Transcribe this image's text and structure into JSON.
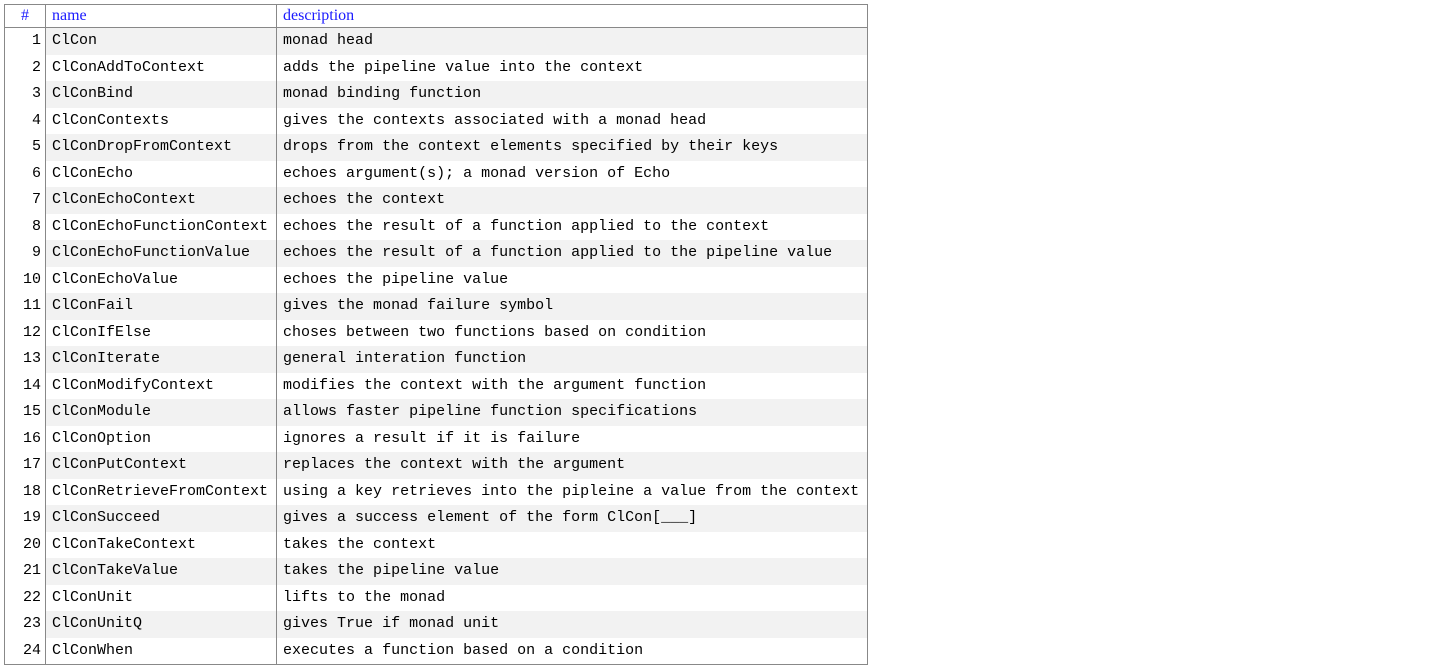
{
  "headers": {
    "index": "#",
    "name": "name",
    "description": "description"
  },
  "rows": [
    {
      "i": "1",
      "name": "ClCon",
      "desc": "monad head"
    },
    {
      "i": "2",
      "name": "ClConAddToContext",
      "desc": "adds the pipeline value into the context"
    },
    {
      "i": "3",
      "name": "ClConBind",
      "desc": "monad binding function"
    },
    {
      "i": "4",
      "name": "ClConContexts",
      "desc": "gives the contexts associated with a monad head"
    },
    {
      "i": "5",
      "name": "ClConDropFromContext",
      "desc": "drops from the context elements specified by their keys"
    },
    {
      "i": "6",
      "name": "ClConEcho",
      "desc": "echoes argument(s); a monad version of Echo"
    },
    {
      "i": "7",
      "name": "ClConEchoContext",
      "desc": "echoes the context"
    },
    {
      "i": "8",
      "name": "ClConEchoFunctionContext",
      "desc": "echoes the result of a function applied to the context"
    },
    {
      "i": "9",
      "name": "ClConEchoFunctionValue",
      "desc": "echoes the result of a function applied to the pipeline value"
    },
    {
      "i": "10",
      "name": "ClConEchoValue",
      "desc": "echoes the pipeline value"
    },
    {
      "i": "11",
      "name": "ClConFail",
      "desc": "gives the monad failure symbol"
    },
    {
      "i": "12",
      "name": "ClConIfElse",
      "desc": "choses between two functions based on condition"
    },
    {
      "i": "13",
      "name": "ClConIterate",
      "desc": "general interation function"
    },
    {
      "i": "14",
      "name": "ClConModifyContext",
      "desc": "modifies the context with the argument function"
    },
    {
      "i": "15",
      "name": "ClConModule",
      "desc": "allows faster pipeline function specifications"
    },
    {
      "i": "16",
      "name": "ClConOption",
      "desc": "ignores a result if it is failure"
    },
    {
      "i": "17",
      "name": "ClConPutContext",
      "desc": "replaces the context with the argument"
    },
    {
      "i": "18",
      "name": "ClConRetrieveFromContext",
      "desc": "using a key retrieves into the pipleine a value from the context"
    },
    {
      "i": "19",
      "name": "ClConSucceed",
      "desc": "gives a success element of the form ClCon[___]"
    },
    {
      "i": "20",
      "name": "ClConTakeContext",
      "desc": "takes the context"
    },
    {
      "i": "21",
      "name": "ClConTakeValue",
      "desc": "takes the pipeline value"
    },
    {
      "i": "22",
      "name": "ClConUnit",
      "desc": "lifts to the monad"
    },
    {
      "i": "23",
      "name": "ClConUnitQ",
      "desc": "gives True if monad unit"
    },
    {
      "i": "24",
      "name": "ClConWhen",
      "desc": "executes a function based on a condition"
    }
  ]
}
